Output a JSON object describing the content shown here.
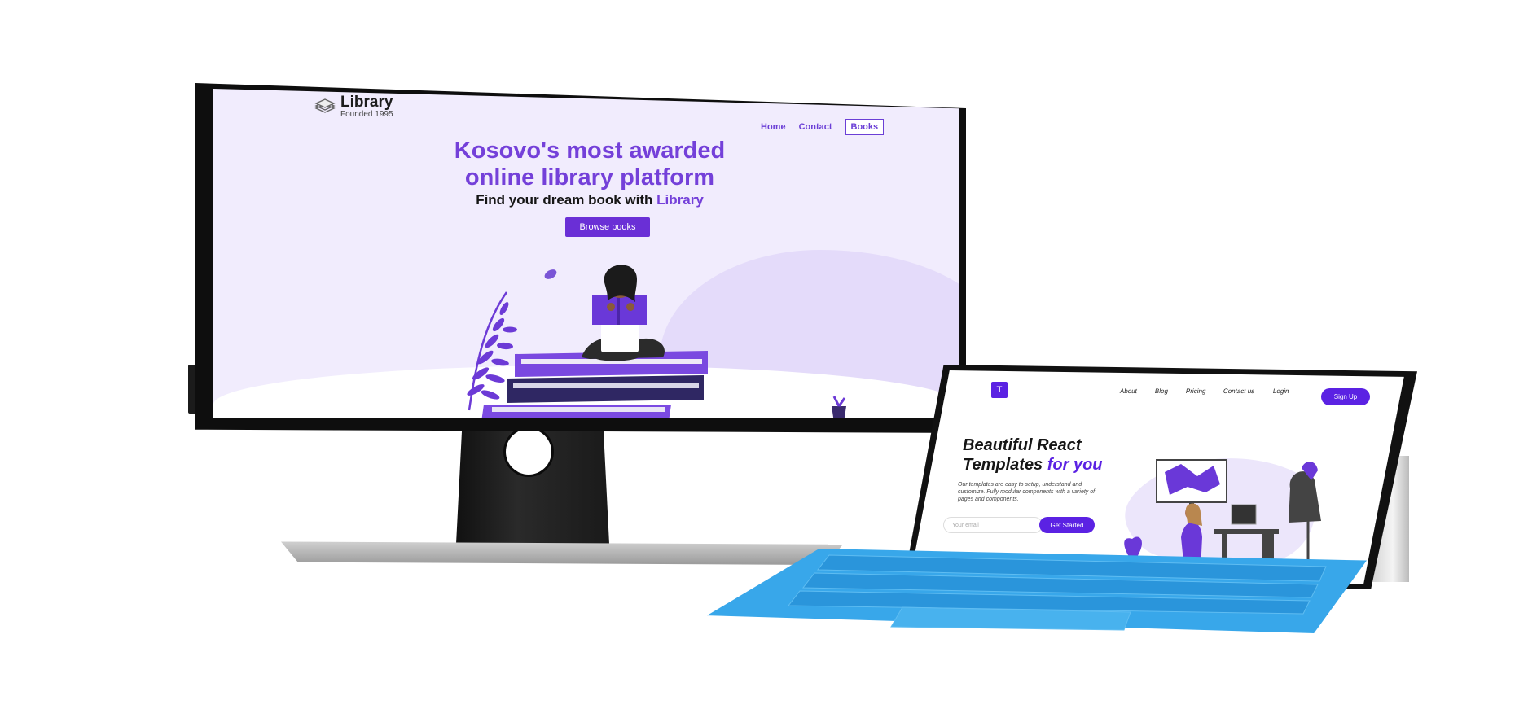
{
  "monitor": {
    "site": {
      "logo_title": "Library",
      "logo_subtitle": "Founded 1995",
      "nav": {
        "home": "Home",
        "contact": "Contact",
        "books": "Books"
      },
      "hero_title_line1": "Kosovo's most awarded",
      "hero_title_line2": "online library platform",
      "hero_sub_prefix": "Find your dream book with ",
      "hero_sub_accent": "Library",
      "browse_button": "Browse books",
      "accent_color": "#7440d9"
    }
  },
  "tablet": {
    "site": {
      "logo_letter": "T",
      "nav": [
        "About",
        "Blog",
        "Pricing",
        "Contact us",
        "Login"
      ],
      "signup_button": "Sign Up",
      "title_line1": "Beautiful React",
      "title_line2_prefix": "Templates ",
      "title_line2_accent": "for you",
      "body_text": "Our templates are easy to setup, understand and customize. Fully modular components with a variety of pages and components.",
      "email_placeholder": "Your email",
      "get_started_button": "Get Started",
      "accent_color": "#5b22e3"
    }
  }
}
